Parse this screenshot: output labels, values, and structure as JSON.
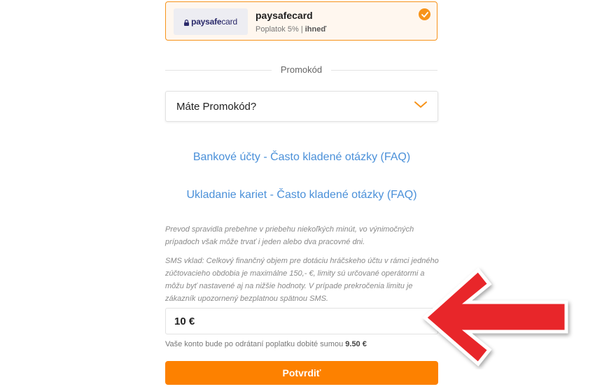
{
  "payment_method": {
    "logo_main": "paysafe",
    "logo_suffix": "card",
    "name": "paysafecard",
    "fee_text": "Poplatok 5% | ",
    "fee_speed": "ihneď",
    "selected": true
  },
  "promo": {
    "divider_label": "Promokód",
    "select_text": "Máte Promokód?"
  },
  "faq": {
    "bank_accounts": "Bankové účty - Často kladené otázky (FAQ)",
    "card_storage": "Ukladanie kariet - Často kladené otázky (FAQ)"
  },
  "info": {
    "transfer_note": "Prevod spravidla prebehne v priebehu niekoľkých minút, vo výnimočných prípadoch však môže trvať i jeden alebo dva pracovné dni.",
    "sms_note": "SMS vklad: Celkový finančný objem pre dotáciu hráčskeho účtu v rámci jedného zúčtovacieho obdobia je maximálne 150,- €, limity sú určované operátormi a môžu byť nastavené aj na nižšie hodnoty. V prípade prekročenia limitu je zákazník upozornený bezplatnou spätnou SMS."
  },
  "amount": {
    "value": "10 €"
  },
  "balance": {
    "note_text": "Vaše konto bude po odrátaní poplatku dobité sumou ",
    "credited_amount": "9.50 €"
  },
  "confirm": {
    "label": "Potvrdiť"
  },
  "colors": {
    "accent": "#fd8100",
    "link": "#4a90d9",
    "arrow": "#e8262a"
  },
  "icons": {
    "check": "check-icon",
    "chevron": "chevron-down-icon",
    "lock": "lock-icon",
    "arrow": "red-arrow-left-icon"
  }
}
